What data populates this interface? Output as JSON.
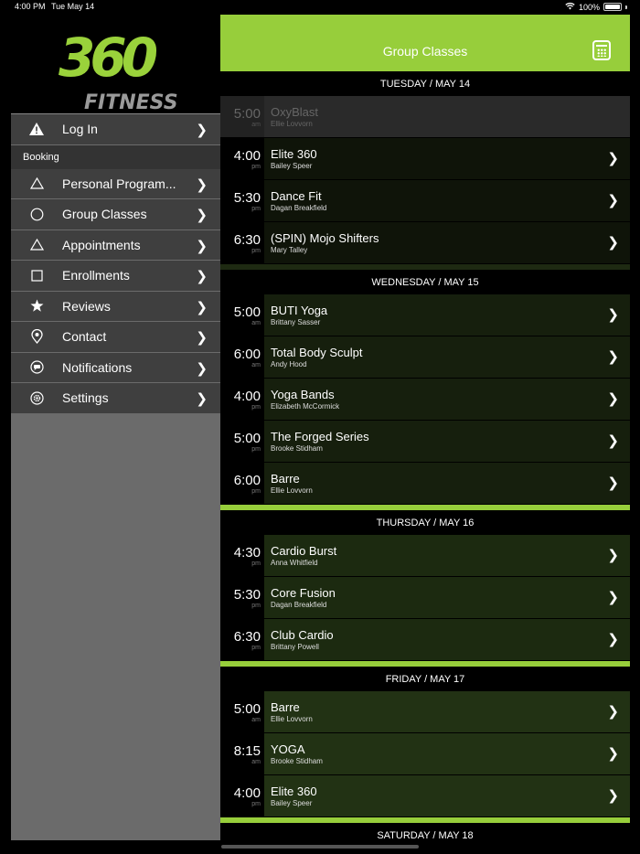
{
  "status_bar": {
    "time": "4:00 PM",
    "date": "Tue May 14",
    "battery": "100%"
  },
  "brand": {
    "logo_number": "360",
    "logo_word": "FITNESS",
    "accent_color": "#97ce3b"
  },
  "sidebar": {
    "login": "Log In",
    "section_label": "Booking",
    "booking_items": [
      {
        "label": "Personal Program...",
        "icon": "triangle-icon"
      },
      {
        "label": "Group Classes",
        "icon": "circle-icon"
      },
      {
        "label": "Appointments",
        "icon": "triangle-icon"
      },
      {
        "label": "Enrollments",
        "icon": "square-icon"
      }
    ],
    "other_items": [
      {
        "label": "Reviews",
        "icon": "star-icon"
      },
      {
        "label": "Contact",
        "icon": "location-pin-icon"
      },
      {
        "label": "Notifications",
        "icon": "chat-bubble-icon"
      },
      {
        "label": "Settings",
        "icon": "gear-icon"
      }
    ]
  },
  "header": {
    "title": "Group Classes"
  },
  "days": [
    {
      "label": "TUESDAY / MAY 14",
      "sessions": [
        {
          "time": "5:00",
          "ampm": "am",
          "name": "OxyBlast",
          "instructor": "Ellie Lovvorn",
          "past": true
        },
        {
          "time": "4:00",
          "ampm": "pm",
          "name": "Elite 360",
          "instructor": "Bailey Speer"
        },
        {
          "time": "5:30",
          "ampm": "pm",
          "name": "Dance Fit",
          "instructor": "Dagan Breakfield"
        },
        {
          "time": "6:30",
          "ampm": "pm",
          "name": "(SPIN) Mojo Shifters",
          "instructor": "Mary Talley"
        }
      ]
    },
    {
      "label": "WEDNESDAY / MAY 15",
      "sessions": [
        {
          "time": "5:00",
          "ampm": "am",
          "name": "BUTI Yoga",
          "instructor": "Brittany Sasser"
        },
        {
          "time": "6:00",
          "ampm": "am",
          "name": "Total Body Sculpt",
          "instructor": "Andy Hood"
        },
        {
          "time": "4:00",
          "ampm": "pm",
          "name": "Yoga Bands",
          "instructor": "Elizabeth McCormick"
        },
        {
          "time": "5:00",
          "ampm": "pm",
          "name": "The Forged Series",
          "instructor": "Brooke Stidham"
        },
        {
          "time": "6:00",
          "ampm": "pm",
          "name": "Barre",
          "instructor": "Ellie Lovvorn"
        }
      ]
    },
    {
      "label": "THURSDAY / MAY 16",
      "sessions": [
        {
          "time": "4:30",
          "ampm": "pm",
          "name": "Cardio Burst",
          "instructor": "Anna Whitfield"
        },
        {
          "time": "5:30",
          "ampm": "pm",
          "name": "Core Fusion",
          "instructor": "Dagan Breakfield"
        },
        {
          "time": "6:30",
          "ampm": "pm",
          "name": "Club Cardio",
          "instructor": "Brittany Powell"
        }
      ]
    },
    {
      "label": "FRIDAY / MAY 17",
      "sessions": [
        {
          "time": "5:00",
          "ampm": "am",
          "name": "Barre",
          "instructor": "Ellie Lovvorn"
        },
        {
          "time": "8:15",
          "ampm": "am",
          "name": "YOGA",
          "instructor": "Brooke Stidham"
        },
        {
          "time": "4:00",
          "ampm": "pm",
          "name": "Elite 360",
          "instructor": "Bailey Speer"
        }
      ]
    },
    {
      "label": "SATURDAY / MAY 18",
      "sessions": []
    }
  ]
}
